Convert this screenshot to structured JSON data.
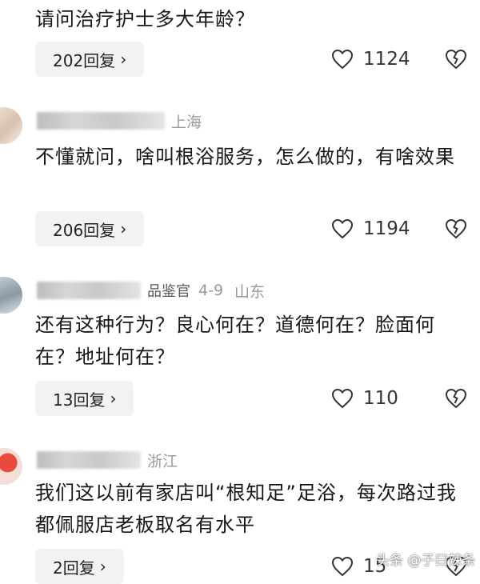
{
  "comments": [
    {
      "text": "请问治疗护士多大年龄？",
      "reply_label": "202回复",
      "likes": "1124"
    },
    {
      "location": "上海",
      "text": "不懂就问，啥叫根浴服务，怎么做的，有啥效果",
      "reply_label": "206回复",
      "likes": "1194"
    },
    {
      "badge": "品鉴官",
      "date": "4-9",
      "location": "山东",
      "text": "还有这种行为？良心何在？道德何在？脸面何在？地址何在？",
      "reply_label": "13回复",
      "likes": "110"
    },
    {
      "location": "浙江",
      "text": "我们这以前有家店叫“根知足”足浴，每次路过我都佩服店老板取名有水平",
      "reply_label": "2回复",
      "likes": "15"
    }
  ],
  "reply_chevron": "›",
  "watermark": "头条 @子曰辣条",
  "icons": {
    "like": "heart-outline-icon",
    "dislike": "broken-heart-icon",
    "chevron": "chevron-right-icon"
  }
}
